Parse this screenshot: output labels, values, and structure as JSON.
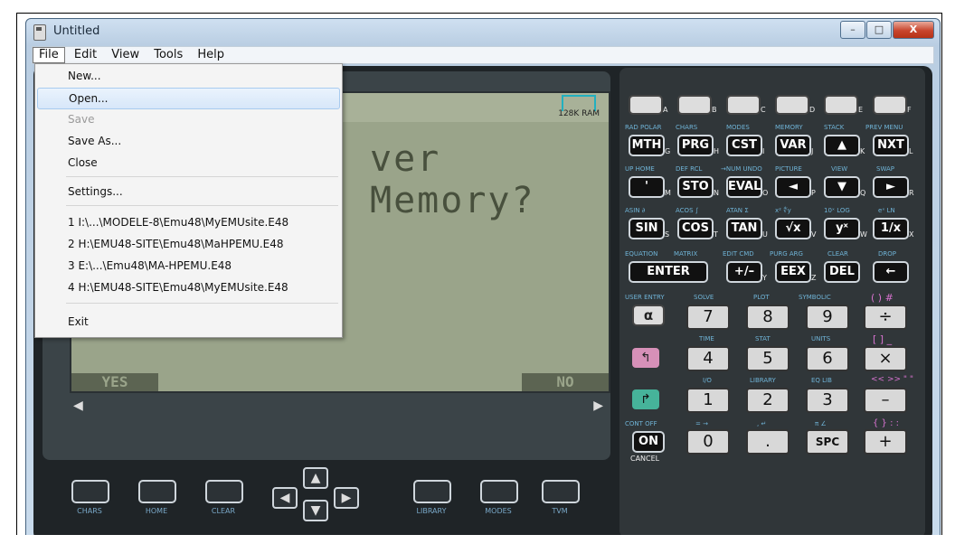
{
  "window": {
    "title": "Untitled",
    "controls": [
      "–",
      "□",
      "X"
    ]
  },
  "menubar": [
    "File",
    "Edit",
    "View",
    "Tools",
    "Help"
  ],
  "file_menu": {
    "items": [
      {
        "label": "New...",
        "state": "normal"
      },
      {
        "label": "Open...",
        "state": "highlighted"
      },
      {
        "label": "Save",
        "state": "disabled"
      },
      {
        "label": "Save As...",
        "state": "normal"
      },
      {
        "label": "Close",
        "state": "normal"
      },
      {
        "label": "Settings...",
        "state": "normal"
      },
      {
        "label": "1 I:\\...\\MODELE-8\\Emu48\\MyEMUsite.E48",
        "state": "normal"
      },
      {
        "label": "2 H:\\EMU48-SITE\\Emu48\\MaHPEMU.E48",
        "state": "normal"
      },
      {
        "label": "3 E:\\...\\Emu48\\MA-HPEMU.E48",
        "state": "normal"
      },
      {
        "label": "4 H:\\EMU48-SITE\\Emu48\\MyEMUsite.E48",
        "state": "normal"
      },
      {
        "label": "Exit",
        "state": "normal"
      }
    ]
  },
  "lcd": {
    "ram": "128K RAM",
    "text": "ver Memory?",
    "soft_left": "YES",
    "soft_right": "NO"
  },
  "softkeys": [
    "CHARS",
    "HOME",
    "CLEAR",
    "LIBRARY",
    "MODES",
    "TVM"
  ],
  "keypad": {
    "row_letters": [
      "A",
      "B",
      "C",
      "D",
      "E",
      "F"
    ],
    "row1_labels": [
      "RAD POLAR",
      "CHARS",
      "MODES",
      "MEMORY",
      "STACK",
      "PREV MENU"
    ],
    "row1_keys": [
      "MTH",
      "PRG",
      "CST",
      "VAR",
      "▲",
      "NXT"
    ],
    "row1_letters": [
      "G",
      "H",
      "I",
      "J",
      "K",
      "L"
    ],
    "row2_labels": [
      "UP HOME",
      "DEF RCL",
      "→NUM UNDO",
      "PICTURE",
      "VIEW",
      "SWAP"
    ],
    "row2_keys": [
      "'",
      "STO",
      "EVAL",
      "◄",
      "▼",
      "►"
    ],
    "row2_letters": [
      "M",
      "N",
      "O",
      "P",
      "Q",
      "R"
    ],
    "row3_labels": [
      "ASIN ∂",
      "ACOS ∫",
      "ATAN Σ",
      "x² ∜y",
      "10ˣ LOG",
      "eˣ LN"
    ],
    "row3_keys": [
      "SIN",
      "COS",
      "TAN",
      "√x",
      "yˣ",
      "1/x"
    ],
    "row3_letters": [
      "S",
      "T",
      "U",
      "V",
      "W",
      "X"
    ],
    "row4_labels": [
      "EQUATION",
      "MATRIX",
      "EDIT CMD",
      "PURG ARG",
      "CLEAR",
      "DROP"
    ],
    "row4_keys": [
      "ENTER",
      "+/–",
      "EEX",
      "DEL",
      "←"
    ],
    "row4_letters": [
      "Y",
      "Z"
    ],
    "num_labels": [
      "USER ENTRY",
      "SOLVE",
      "PLOT",
      "SYMBOLIC",
      "( ) #",
      "TIME",
      "STAT",
      "UNITS",
      "[ ] _",
      "I/O",
      "LIBRARY",
      "EQ LIB",
      "<< >> \" \"",
      "CONT OFF",
      "= →",
      ", ↵",
      "π ∠",
      "{ } : :"
    ],
    "numbers": [
      "7",
      "8",
      "9",
      "÷",
      "4",
      "5",
      "6",
      "×",
      "1",
      "2",
      "3",
      "–",
      "0",
      ".",
      "SPC",
      "+"
    ],
    "alpha": "α",
    "on": "ON",
    "cancel": "CANCEL"
  }
}
